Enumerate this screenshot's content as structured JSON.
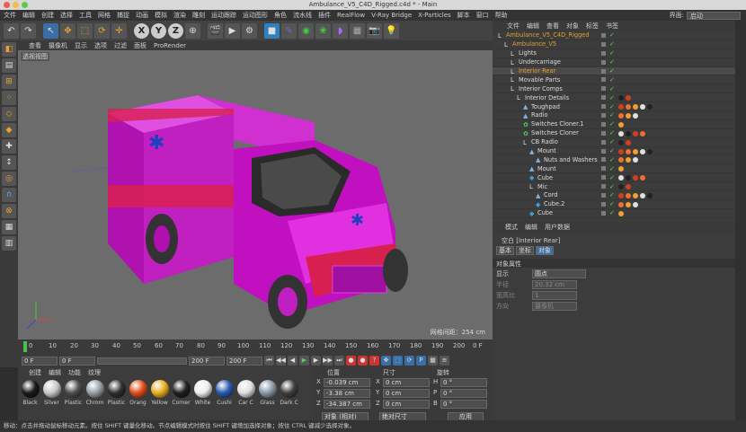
{
  "window": {
    "title": "Ambulance_V5_C4D_Rigged.c4d * - Main"
  },
  "menu": {
    "items": [
      "文件",
      "编辑",
      "创建",
      "选择",
      "工具",
      "网格",
      "捕捉",
      "动画",
      "模拟",
      "渲染",
      "雕刻",
      "运动跟踪",
      "运动图形",
      "角色",
      "流水线",
      "插件",
      "RealFlow",
      "V-Ray Bridge",
      "X-Particles",
      "脚本",
      "窗口",
      "帮助"
    ],
    "layout_label": "界面:",
    "layout_value": "启动"
  },
  "toolbar": {
    "icons": [
      "undo-icon",
      "redo-icon",
      "live-select-icon",
      "move-icon",
      "scale-icon",
      "rotate-icon",
      "recent-icon",
      "x-axis-icon",
      "y-axis-icon",
      "z-axis-icon",
      "world-coord-icon",
      "render-view-icon",
      "render-pv-icon",
      "render-settings-icon",
      "cube-icon",
      "pen-icon",
      "subdiv-icon",
      "array-icon",
      "deformer-icon",
      "scene-icon",
      "camera-icon",
      "light-icon"
    ],
    "axis_labels": [
      "X",
      "Y",
      "Z"
    ]
  },
  "viewport": {
    "menu": [
      "查看",
      "摄像机",
      "显示",
      "选项",
      "过滤",
      "面板",
      "ProRender"
    ],
    "view_label": "透视视图",
    "grid_label": "网格间距：254 cm"
  },
  "timeline": {
    "ticks": [
      "0",
      "10",
      "20",
      "30",
      "40",
      "50",
      "60",
      "70",
      "80",
      "90",
      "100",
      "110",
      "120",
      "130",
      "140",
      "150",
      "160",
      "170",
      "180",
      "190",
      "200"
    ],
    "frame_end": "0 F"
  },
  "playback": {
    "start": "0 F",
    "current": "0 F",
    "end": "200 F",
    "end2": "200 F"
  },
  "materials": {
    "menu": [
      "创建",
      "编辑",
      "功能",
      "纹理"
    ],
    "items": [
      {
        "label": "Black",
        "color": "#1a1a1a"
      },
      {
        "label": "Silver",
        "color": "#c8c8c8"
      },
      {
        "label": "Plastic",
        "color": "#505050"
      },
      {
        "label": "Chrom",
        "color": "#9aa0a8"
      },
      {
        "label": "Plastic",
        "color": "#303030"
      },
      {
        "label": "Orang",
        "color": "#e0501a"
      },
      {
        "label": "Yellow",
        "color": "#e8b020"
      },
      {
        "label": "Corner",
        "color": "#202020"
      },
      {
        "label": "White",
        "color": "#eeeeee"
      },
      {
        "label": "Cushi",
        "color": "#2a5ab0"
      },
      {
        "label": "Car C",
        "color": "#e0e0e0"
      },
      {
        "label": "Glass",
        "color": "#8a9aa8"
      },
      {
        "label": "Dark C",
        "color": "#404040"
      }
    ]
  },
  "coords": {
    "headers": [
      "位置",
      "尺寸",
      "旋转"
    ],
    "rows": [
      {
        "axis": "X",
        "pos": "-0.039 cm",
        "size": "0 cm",
        "rot_axis": "H",
        "rot": "0 °"
      },
      {
        "axis": "Y",
        "pos": "-3.38 cm",
        "size": "0 cm",
        "rot_axis": "P",
        "rot": "0 °"
      },
      {
        "axis": "Z",
        "pos": "-34.387 cm",
        "size": "0 cm",
        "rot_axis": "B",
        "rot": "0 °"
      }
    ],
    "mode": "对象 (相对)",
    "size_mode": "绝对尺寸",
    "apply": "应用"
  },
  "status": {
    "text": "移动：点击并拖动鼠标移动元素。按住 SHIFT 键量化移动。节点编辑模式时按住 SHIFT 键增加选择对象；按住 CTRL 键减少选择对象。"
  },
  "objects": {
    "tabs": [
      "文件",
      "编辑",
      "查看",
      "对象",
      "标签",
      "书签"
    ],
    "rows": [
      {
        "name": "Ambulance_V5_C4D_Rigged",
        "indent": 0,
        "color": "#e0a030",
        "icon": "null-icon"
      },
      {
        "name": "Ambulance_V5",
        "indent": 1,
        "color": "#e0a030",
        "icon": "null-icon"
      },
      {
        "name": "Lights",
        "indent": 2,
        "color": "#dcdcdc",
        "icon": "null-icon"
      },
      {
        "name": "Undercarriage",
        "indent": 2,
        "color": "#dcdcdc",
        "icon": "null-icon"
      },
      {
        "name": "Interior Rear",
        "indent": 2,
        "color": "#f0a020",
        "icon": "null-icon"
      },
      {
        "name": "Movable Parts",
        "indent": 2,
        "color": "#dcdcdc",
        "icon": "null-icon"
      },
      {
        "name": "Interior Comps",
        "indent": 2,
        "color": "#dcdcdc",
        "icon": "null-icon"
      },
      {
        "name": "Interior Details",
        "indent": 3,
        "color": "#dcdcdc",
        "icon": "null-icon"
      },
      {
        "name": "Toughpad",
        "indent": 4,
        "color": "#dcdcdc",
        "icon": "poly-icon"
      },
      {
        "name": "Radio",
        "indent": 4,
        "color": "#dcdcdc",
        "icon": "poly-icon"
      },
      {
        "name": "Switches Cloner.1",
        "indent": 4,
        "color": "#dcdcdc",
        "icon": "cloner-icon"
      },
      {
        "name": "Switches Cloner",
        "indent": 4,
        "color": "#dcdcdc",
        "icon": "cloner-icon"
      },
      {
        "name": "CB Radio",
        "indent": 4,
        "color": "#dcdcdc",
        "icon": "null-icon"
      },
      {
        "name": "Mount",
        "indent": 5,
        "color": "#dcdcdc",
        "icon": "poly-icon"
      },
      {
        "name": "Nuts and Washers",
        "indent": 6,
        "color": "#dcdcdc",
        "icon": "poly-icon"
      },
      {
        "name": "Mount",
        "indent": 5,
        "color": "#dcdcdc",
        "icon": "poly-icon"
      },
      {
        "name": "Cube",
        "indent": 5,
        "color": "#dcdcdc",
        "icon": "cube-icon"
      },
      {
        "name": "Mic",
        "indent": 5,
        "color": "#dcdcdc",
        "icon": "null-icon"
      },
      {
        "name": "Cord",
        "indent": 6,
        "color": "#dcdcdc",
        "icon": "poly-icon"
      },
      {
        "name": "Cube.2",
        "indent": 6,
        "color": "#dcdcdc",
        "icon": "cube-icon"
      },
      {
        "name": "Cube",
        "indent": 5,
        "color": "#dcdcdc",
        "icon": "cube-icon"
      }
    ]
  },
  "attributes": {
    "tabs": [
      "模式",
      "编辑",
      "用户数据"
    ],
    "object_title": "空白 [Interior Rear]",
    "subtabs": [
      "基本",
      "坐标",
      "对象"
    ],
    "section": "对象属性",
    "fields": [
      {
        "label": "显示",
        "value": "圆点"
      },
      {
        "label": "半径",
        "value": "20.32 cm"
      },
      {
        "label": "宽高比",
        "value": "1"
      },
      {
        "label": "方向",
        "value": "摄像机"
      }
    ]
  }
}
